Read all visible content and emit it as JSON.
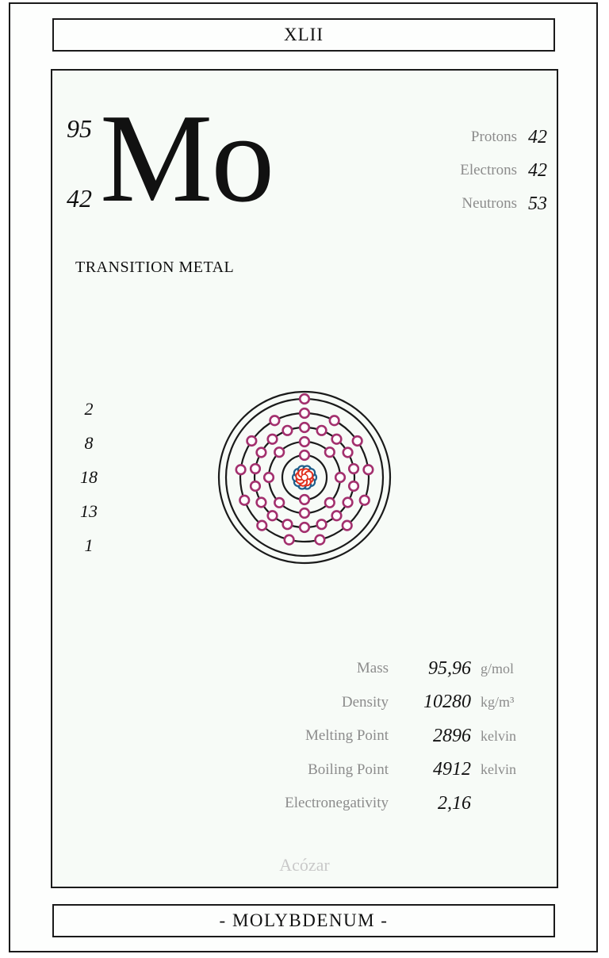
{
  "header": {
    "roman_numeral": "XLII"
  },
  "element": {
    "mass_number": "95",
    "atomic_number": "42",
    "symbol": "Mo",
    "category": "TRANSITION METAL",
    "name": "- MOLYBDENUM -"
  },
  "particles": [
    {
      "label": "Protons",
      "value": "42"
    },
    {
      "label": "Electrons",
      "value": "42"
    },
    {
      "label": "Neutrons",
      "value": "53"
    }
  ],
  "electron_shells": [
    "2",
    "8",
    "18",
    "13",
    "1"
  ],
  "properties": [
    {
      "label": "Mass",
      "value": "95,96",
      "unit": "g/mol"
    },
    {
      "label": "Density",
      "value": "10280",
      "unit": "kg/m³"
    },
    {
      "label": "Melting Point",
      "value": "2896",
      "unit": "kelvin"
    },
    {
      "label": "Boiling Point",
      "value": "4912",
      "unit": "kelvin"
    },
    {
      "label": "Electronegativity",
      "value": "2,16",
      "unit": ""
    }
  ],
  "footer": {
    "author": "Acózar"
  },
  "colors": {
    "electron": "#a3306e",
    "proton": "#e0301e",
    "neutron": "#1f5f8b",
    "border": "#1a1a1a",
    "muted_text": "#8c8c8c"
  }
}
